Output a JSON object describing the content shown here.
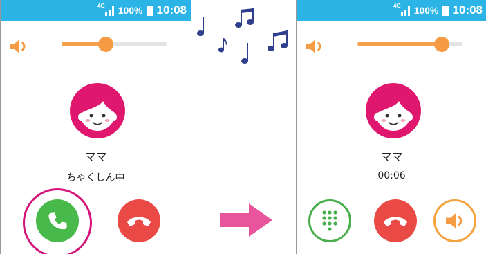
{
  "colors": {
    "status_bar": "#2db4e6",
    "accent_orange": "#f59b43",
    "answer_green": "#48b94b",
    "hangup_red": "#ea4a45",
    "highlight_magenta": "#d6157b",
    "arrow_pink": "#e9559c",
    "note_navy": "#2f3f8c"
  },
  "left_screen": {
    "status_bar": {
      "network": "4G",
      "battery": "100%",
      "time": "10:08"
    },
    "volume": {
      "icon": "speaker-icon",
      "level": 0.42
    },
    "caller": {
      "avatar": "girl-avatar-icon",
      "name": "ママ",
      "status": "ちゃくしん中"
    },
    "buttons": [
      {
        "name": "answer-button",
        "icon": "phone-icon"
      },
      {
        "name": "hangup-button",
        "icon": "phone-hangup-icon"
      }
    ]
  },
  "right_screen": {
    "status_bar": {
      "network": "4G",
      "battery": "100%",
      "time": "10:08"
    },
    "volume": {
      "icon": "speaker-icon",
      "level": 0.8
    },
    "caller": {
      "avatar": "girl-avatar-icon",
      "name": "ママ",
      "duration": "00:06"
    },
    "buttons": [
      {
        "name": "keypad-button",
        "icon": "keypad-icon"
      },
      {
        "name": "hangup-button",
        "icon": "phone-hangup-icon"
      },
      {
        "name": "speaker-button",
        "icon": "speaker-icon"
      }
    ]
  },
  "decorations": {
    "music_notes": "music-notes-icon",
    "arrow": "arrow-right-icon"
  }
}
